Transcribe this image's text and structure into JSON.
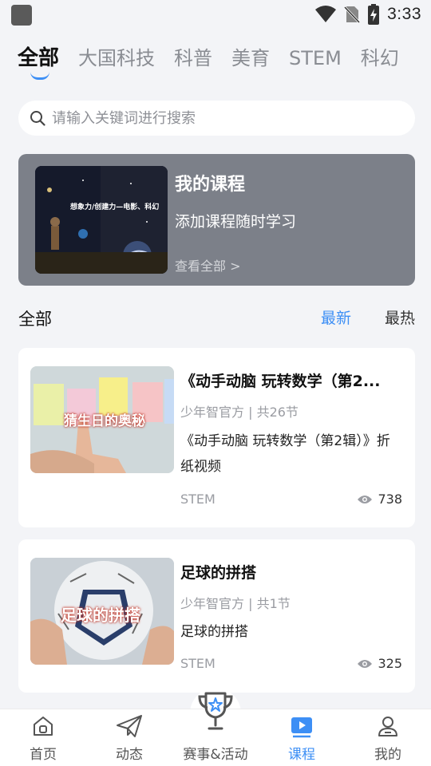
{
  "status": {
    "time": "3:33"
  },
  "tabs": [
    {
      "label": "全部",
      "active": true
    },
    {
      "label": "大国科技"
    },
    {
      "label": "科普"
    },
    {
      "label": "美育"
    },
    {
      "label": "STEM"
    },
    {
      "label": "科幻"
    }
  ],
  "search": {
    "placeholder": "请输入关键词进行搜索"
  },
  "my_course": {
    "title": "我的课程",
    "subtitle": "添加课程随时学习",
    "link": "查看全部 >",
    "thumb_heading": "想象力/创建力—电影、科幻"
  },
  "section": {
    "title": "全部",
    "sort_newest": "最新",
    "sort_hottest": "最热"
  },
  "courses": [
    {
      "title": "《动手动脑 玩转数学（第2...",
      "meta": "少年智官方 | 共26节",
      "desc": "《动手动脑 玩转数学（第2辑）》折纸视频",
      "tag": "STEM",
      "views": "738",
      "thumb_caption": "猜生日的奥秘"
    },
    {
      "title": "足球的拼搭",
      "meta": "少年智官方 | 共1节",
      "desc": "足球的拼搭",
      "tag": "STEM",
      "views": "325",
      "thumb_caption": "足球的拼搭"
    }
  ],
  "nav": [
    {
      "label": "首页",
      "icon": "home-icon"
    },
    {
      "label": "动态",
      "icon": "send-icon"
    },
    {
      "label": "赛事&活动",
      "icon": "trophy-icon"
    },
    {
      "label": "课程",
      "icon": "course-play-icon",
      "active": true
    },
    {
      "label": "我的",
      "icon": "user-icon"
    }
  ],
  "colors": {
    "accent": "#3d8ff5",
    "banner": "#7c8089",
    "background": "#f3f4f7"
  }
}
